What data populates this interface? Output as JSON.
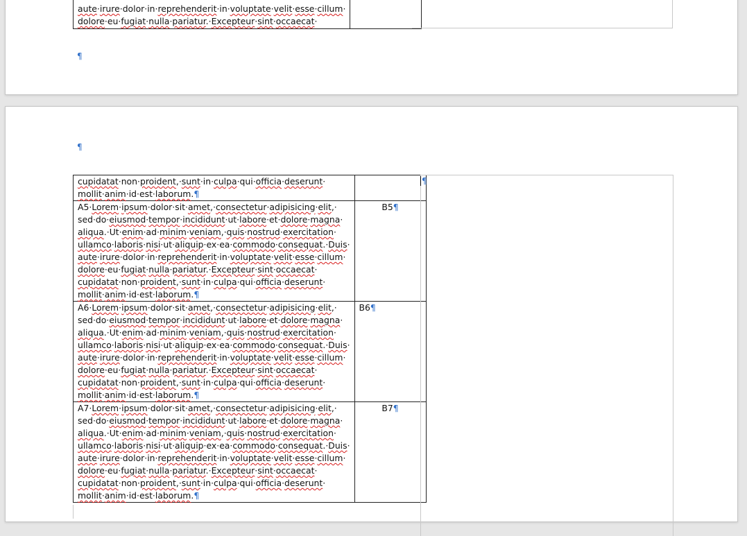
{
  "page1": {
    "cut_row": {
      "lines": [
        "aute·irure·dolor·in·reprehenderit·in·voluptate·velit·esse·cillum·",
        "dolore·eu·fugiat·nulla·pariatur.·Excepteur·sint·occaecat·"
      ]
    },
    "paragraph_mark": "¶"
  },
  "page2": {
    "paragraph_mark": "¶",
    "side_cell_mark": "¶",
    "rows": [
      {
        "a_lines": [
          "cupidatat·non·proident,·sunt·in·culpa·qui·officia·deserunt·",
          "mollit·anim·id·est·laborum."
        ],
        "b": "",
        "b_align": "center"
      },
      {
        "a_lines": [
          "A5·Lorem·ipsum·dolor·sit·amet,·consectetur·adipisicing·elit,·",
          "sed·do·eiusmod·tempor·incididunt·ut·labore·et·dolore·magna·",
          "aliqua.·Ut·enim·ad·minim·veniam,·quis·nostrud·exercitation·",
          "ullamco·laboris·nisi·ut·aliquip·ex·ea·commodo·consequat.·Duis·",
          "aute·irure·dolor·in·reprehenderit·in·voluptate·velit·esse·cillum·",
          "dolore·eu·fugiat·nulla·pariatur.·Excepteur·sint·occaecat·",
          "cupidatat·non·proident,·sunt·in·culpa·qui·officia·deserunt·",
          "mollit·anim·id·est·laborum."
        ],
        "b": "B5",
        "b_align": "center"
      },
      {
        "a_lines": [
          "A6·Lorem·ipsum·dolor·sit·amet,·consectetur·adipisicing·elit,·",
          "sed·do·eiusmod·tempor·incididunt·ut·labore·et·dolore·magna·",
          "aliqua.·Ut·enim·ad·minim·veniam,·quis·nostrud·exercitation·",
          "ullamco·laboris·nisi·ut·aliquip·ex·ea·commodo·consequat.·Duis·",
          "aute·irure·dolor·in·reprehenderit·in·voluptate·velit·esse·cillum·",
          "dolore·eu·fugiat·nulla·pariatur.·Excepteur·sint·occaecat·",
          "cupidatat·non·proident,·sunt·in·culpa·qui·officia·deserunt·",
          "mollit·anim·id·est·laborum."
        ],
        "b": "B6",
        "b_align": "left"
      },
      {
        "a_lines": [
          "A7·Lorem·ipsum·dolor·sit·amet,·consectetur·adipisicing·elit,·",
          "sed·do·eiusmod·tempor·incididunt·ut·labore·et·dolore·magna·",
          "aliqua.·Ut·enim·ad·minim·veniam,·quis·nostrud·exercitation·",
          "ullamco·laboris·nisi·ut·aliquip·ex·ea·commodo·consequat.·Duis·",
          "aute·irure·dolor·in·reprehenderit·in·voluptate·velit·esse·cillum·",
          "dolore·eu·fugiat·nulla·pariatur.·Excepteur·sint·occaecat·",
          "cupidatat·non·proident,·sunt·in·culpa·qui·officia·deserunt·",
          "mollit·anim·id·est·laborum."
        ],
        "b": "B7",
        "b_align": "center"
      }
    ]
  },
  "colors": {
    "pilcrow": "#2f6fc9",
    "spell_underline": "#d81b1b",
    "workspace": "#e6e6e6",
    "page": "#ffffff"
  }
}
